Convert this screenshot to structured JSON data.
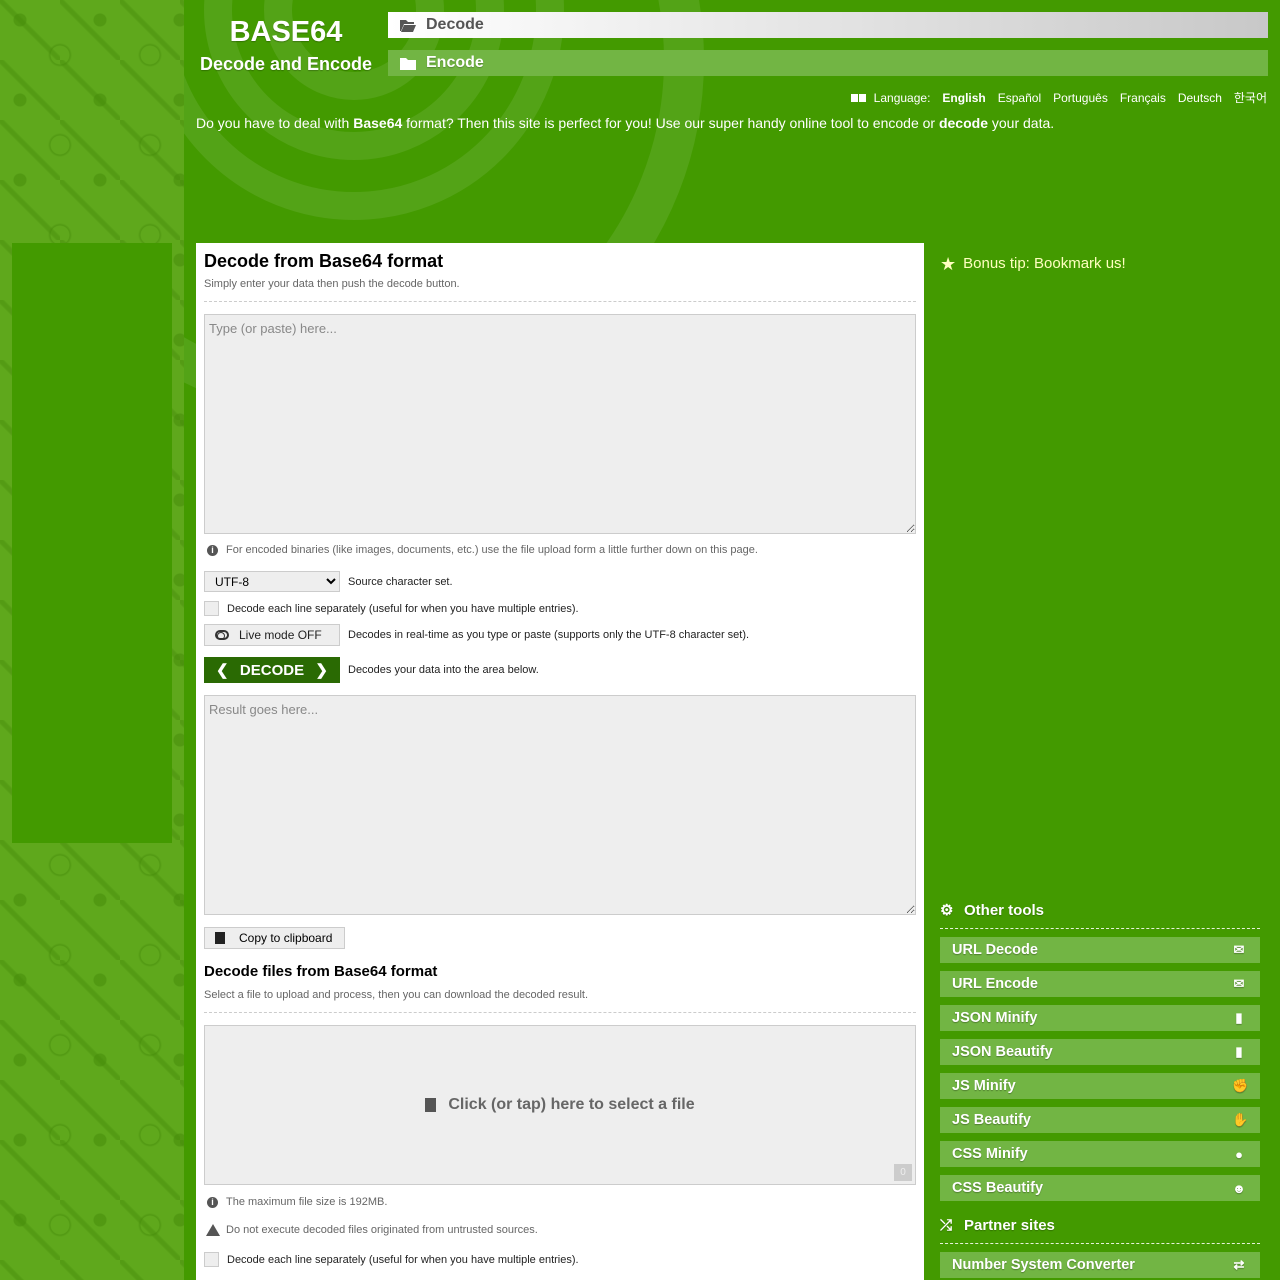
{
  "header": {
    "logo_title": "BASE64",
    "logo_subtitle": "Decode and Encode",
    "nav": [
      {
        "label": "Decode",
        "icon": "folder-open-icon",
        "active": true
      },
      {
        "label": "Encode",
        "icon": "folder-icon",
        "active": false
      }
    ],
    "language": {
      "label": "Language:",
      "icon": "language-icon",
      "options": [
        "English",
        "Español",
        "Português",
        "Français",
        "Deutsch",
        "한국어"
      ],
      "selected": "English"
    },
    "intro": {
      "part1": "Do you have to deal with ",
      "bold1": "Base64",
      "part2": " format? Then this site is perfect for you! Use our super handy online tool to encode or ",
      "bold2": "decode",
      "part3": " your data."
    }
  },
  "decode_section": {
    "title": "Decode from Base64 format",
    "subtitle": "Simply enter your data then push the decode button.",
    "input_placeholder": "Type (or paste) here...",
    "input_value": "",
    "binary_note": "For encoded binaries (like images, documents, etc.) use the file upload form a little further down on this page.",
    "charset": {
      "selected": "UTF-8",
      "label": "Source character set."
    },
    "each_line_label": "Decode each line separately (useful for when you have multiple entries).",
    "each_line_checked": false,
    "live_mode": {
      "label": "Live mode OFF",
      "description": "Decodes in real-time as you type or paste (supports only the UTF-8 character set)."
    },
    "decode_button": {
      "label": "DECODE",
      "description": "Decodes your data into the area below."
    },
    "result_placeholder": "Result goes here...",
    "result_value": "",
    "copy_button": "Copy to clipboard"
  },
  "file_section": {
    "title": "Decode files from Base64 format",
    "subtitle": "Select a file to upload and process, then you can download the decoded result.",
    "upload_label": "Click (or tap) here to select a file",
    "file_count": "0",
    "max_size_note": "The maximum file size is 192MB.",
    "warning_note": "Do not execute decoded files originated from untrusted sources.",
    "each_line_label": "Decode each line separately (useful for when you have multiple entries).",
    "each_line_checked": false
  },
  "sidebar": {
    "bonus_tip": "Bonus tip: Bookmark us!",
    "other_tools": {
      "title": "Other tools",
      "items": [
        {
          "label": "URL Decode",
          "icon": "envelope-open-icon",
          "glyph": "✉"
        },
        {
          "label": "URL Encode",
          "icon": "envelope-icon",
          "glyph": "✉"
        },
        {
          "label": "JSON Minify",
          "icon": "file-archive-icon",
          "glyph": "▮"
        },
        {
          "label": "JSON Beautify",
          "icon": "file-code-icon",
          "glyph": "▮"
        },
        {
          "label": "JS Minify",
          "icon": "hand-rock-icon",
          "glyph": "✊"
        },
        {
          "label": "JS Beautify",
          "icon": "hand-paper-icon",
          "glyph": "✋"
        },
        {
          "label": "CSS Minify",
          "icon": "meh-icon",
          "glyph": "●"
        },
        {
          "label": "CSS Beautify",
          "icon": "smile-icon",
          "glyph": "☻"
        }
      ]
    },
    "partner_sites": {
      "title": "Partner sites",
      "items": [
        {
          "label": "Number System Converter",
          "icon": "exchange-icon",
          "glyph": "⇄"
        }
      ]
    }
  },
  "colors": {
    "brand_green": "#439a00",
    "light_green": "#72b544",
    "dark_green_button": "#2a6a03",
    "bonus_yellow": "#ffffc0"
  }
}
